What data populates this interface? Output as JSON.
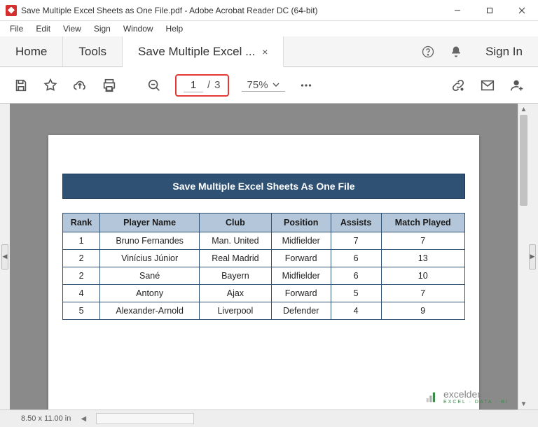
{
  "window": {
    "title": "Save Multiple Excel Sheets as One File.pdf - Adobe Acrobat Reader DC (64-bit)"
  },
  "menubar": {
    "items": [
      "File",
      "Edit",
      "View",
      "Sign",
      "Window",
      "Help"
    ]
  },
  "tabs": {
    "home": "Home",
    "tools": "Tools",
    "doc": "Save Multiple Excel ...",
    "signin": "Sign In"
  },
  "toolbar": {
    "page_current": "1",
    "page_sep": "/",
    "page_total": "3",
    "zoom": "75%"
  },
  "document": {
    "banner": "Save Multiple Excel Sheets As One File",
    "headers": [
      "Rank",
      "Player Name",
      "Club",
      "Position",
      "Assists",
      "Match Played"
    ],
    "rows": [
      [
        "1",
        "Bruno Fernandes",
        "Man. United",
        "Midfielder",
        "7",
        "7"
      ],
      [
        "2",
        "Vinícius Júnior",
        "Real Madrid",
        "Forward",
        "6",
        "13"
      ],
      [
        "2",
        "Sané",
        "Bayern",
        "Midfielder",
        "6",
        "10"
      ],
      [
        "4",
        "Antony",
        "Ajax",
        "Forward",
        "5",
        "7"
      ],
      [
        "5",
        "Alexander-Arnold",
        "Liverpool",
        "Defender",
        "4",
        "9"
      ]
    ]
  },
  "statusbar": {
    "dims": "8.50 x 11.00 in"
  },
  "watermark": {
    "text": "exceldemy",
    "sub": "EXCEL · DATA · BI"
  }
}
